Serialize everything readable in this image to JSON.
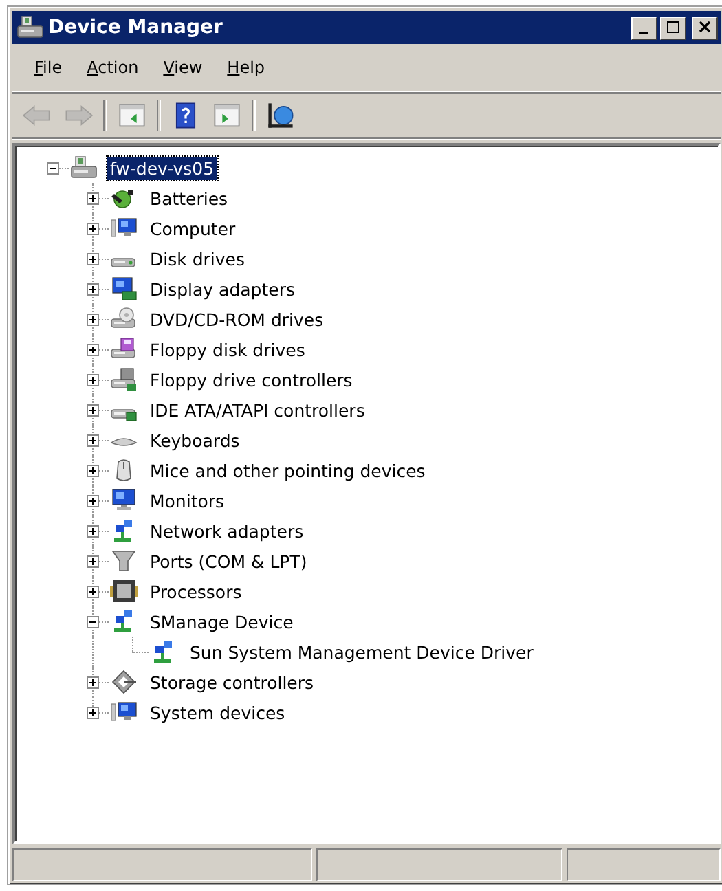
{
  "window": {
    "title": "Device Manager"
  },
  "menu": [
    {
      "label": "File"
    },
    {
      "label": "Action"
    },
    {
      "label": "View"
    },
    {
      "label": "Help"
    }
  ],
  "toolbar": [
    {
      "kind": "back",
      "disabled": true
    },
    {
      "kind": "forward",
      "disabled": true
    },
    {
      "kind": "separator"
    },
    {
      "kind": "show-pane",
      "disabled": false
    },
    {
      "kind": "separator"
    },
    {
      "kind": "help",
      "disabled": false
    },
    {
      "kind": "hide-pane",
      "disabled": false
    },
    {
      "kind": "separator"
    },
    {
      "kind": "scan",
      "disabled": false
    }
  ],
  "tree": [
    {
      "label": "fw-dev-vs05",
      "kind": "server",
      "expanded": true,
      "selected": true,
      "children": [
        {
          "label": "Batteries",
          "kind": "battery",
          "expanded": false,
          "selected": false
        },
        {
          "label": "Computer",
          "kind": "computer",
          "expanded": false,
          "selected": false
        },
        {
          "label": "Disk drives",
          "kind": "disk",
          "expanded": false,
          "selected": false
        },
        {
          "label": "Display adapters",
          "kind": "display",
          "expanded": false,
          "selected": false
        },
        {
          "label": "DVD/CD-ROM drives",
          "kind": "dvd",
          "expanded": false,
          "selected": false
        },
        {
          "label": "Floppy disk drives",
          "kind": "floppy",
          "expanded": false,
          "selected": false
        },
        {
          "label": "Floppy drive controllers",
          "kind": "floppy-controller",
          "expanded": false,
          "selected": false
        },
        {
          "label": "IDE ATA/ATAPI controllers",
          "kind": "ide",
          "expanded": false,
          "selected": false
        },
        {
          "label": "Keyboards",
          "kind": "keyboard",
          "expanded": false,
          "selected": false
        },
        {
          "label": "Mice and other pointing devices",
          "kind": "mouse",
          "expanded": false,
          "selected": false
        },
        {
          "label": "Monitors",
          "kind": "monitor",
          "expanded": false,
          "selected": false
        },
        {
          "label": "Network adapters",
          "kind": "network",
          "expanded": false,
          "selected": false
        },
        {
          "label": "Ports (COM & LPT)",
          "kind": "port",
          "expanded": false,
          "selected": false
        },
        {
          "label": "Processors",
          "kind": "processor",
          "expanded": false,
          "selected": false
        },
        {
          "label": "SManage Device",
          "kind": "network",
          "expanded": true,
          "selected": false,
          "children": [
            {
              "label": "Sun System Management Device Driver",
              "kind": "network",
              "selected": false
            }
          ]
        },
        {
          "label": "Storage controllers",
          "kind": "storage",
          "expanded": false,
          "selected": false
        },
        {
          "label": "System devices",
          "kind": "computer",
          "expanded": false,
          "selected": false
        }
      ]
    }
  ]
}
